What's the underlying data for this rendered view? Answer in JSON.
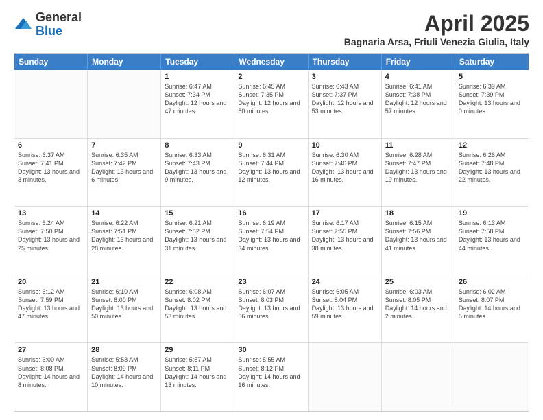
{
  "header": {
    "logo_general": "General",
    "logo_blue": "Blue",
    "month_title": "April 2025",
    "location": "Bagnaria Arsa, Friuli Venezia Giulia, Italy"
  },
  "day_names": [
    "Sunday",
    "Monday",
    "Tuesday",
    "Wednesday",
    "Thursday",
    "Friday",
    "Saturday"
  ],
  "weeks": [
    [
      {
        "day": "",
        "empty": true
      },
      {
        "day": "",
        "empty": true
      },
      {
        "day": "1",
        "sunrise": "6:47 AM",
        "sunset": "7:34 PM",
        "daylight": "12 hours and 47 minutes."
      },
      {
        "day": "2",
        "sunrise": "6:45 AM",
        "sunset": "7:35 PM",
        "daylight": "12 hours and 50 minutes."
      },
      {
        "day": "3",
        "sunrise": "6:43 AM",
        "sunset": "7:37 PM",
        "daylight": "12 hours and 53 minutes."
      },
      {
        "day": "4",
        "sunrise": "6:41 AM",
        "sunset": "7:38 PM",
        "daylight": "12 hours and 57 minutes."
      },
      {
        "day": "5",
        "sunrise": "6:39 AM",
        "sunset": "7:39 PM",
        "daylight": "13 hours and 0 minutes."
      }
    ],
    [
      {
        "day": "6",
        "sunrise": "6:37 AM",
        "sunset": "7:41 PM",
        "daylight": "13 hours and 3 minutes."
      },
      {
        "day": "7",
        "sunrise": "6:35 AM",
        "sunset": "7:42 PM",
        "daylight": "13 hours and 6 minutes."
      },
      {
        "day": "8",
        "sunrise": "6:33 AM",
        "sunset": "7:43 PM",
        "daylight": "13 hours and 9 minutes."
      },
      {
        "day": "9",
        "sunrise": "6:31 AM",
        "sunset": "7:44 PM",
        "daylight": "13 hours and 12 minutes."
      },
      {
        "day": "10",
        "sunrise": "6:30 AM",
        "sunset": "7:46 PM",
        "daylight": "13 hours and 16 minutes."
      },
      {
        "day": "11",
        "sunrise": "6:28 AM",
        "sunset": "7:47 PM",
        "daylight": "13 hours and 19 minutes."
      },
      {
        "day": "12",
        "sunrise": "6:26 AM",
        "sunset": "7:48 PM",
        "daylight": "13 hours and 22 minutes."
      }
    ],
    [
      {
        "day": "13",
        "sunrise": "6:24 AM",
        "sunset": "7:50 PM",
        "daylight": "13 hours and 25 minutes."
      },
      {
        "day": "14",
        "sunrise": "6:22 AM",
        "sunset": "7:51 PM",
        "daylight": "13 hours and 28 minutes."
      },
      {
        "day": "15",
        "sunrise": "6:21 AM",
        "sunset": "7:52 PM",
        "daylight": "13 hours and 31 minutes."
      },
      {
        "day": "16",
        "sunrise": "6:19 AM",
        "sunset": "7:54 PM",
        "daylight": "13 hours and 34 minutes."
      },
      {
        "day": "17",
        "sunrise": "6:17 AM",
        "sunset": "7:55 PM",
        "daylight": "13 hours and 38 minutes."
      },
      {
        "day": "18",
        "sunrise": "6:15 AM",
        "sunset": "7:56 PM",
        "daylight": "13 hours and 41 minutes."
      },
      {
        "day": "19",
        "sunrise": "6:13 AM",
        "sunset": "7:58 PM",
        "daylight": "13 hours and 44 minutes."
      }
    ],
    [
      {
        "day": "20",
        "sunrise": "6:12 AM",
        "sunset": "7:59 PM",
        "daylight": "13 hours and 47 minutes."
      },
      {
        "day": "21",
        "sunrise": "6:10 AM",
        "sunset": "8:00 PM",
        "daylight": "13 hours and 50 minutes."
      },
      {
        "day": "22",
        "sunrise": "6:08 AM",
        "sunset": "8:02 PM",
        "daylight": "13 hours and 53 minutes."
      },
      {
        "day": "23",
        "sunrise": "6:07 AM",
        "sunset": "8:03 PM",
        "daylight": "13 hours and 56 minutes."
      },
      {
        "day": "24",
        "sunrise": "6:05 AM",
        "sunset": "8:04 PM",
        "daylight": "13 hours and 59 minutes."
      },
      {
        "day": "25",
        "sunrise": "6:03 AM",
        "sunset": "8:05 PM",
        "daylight": "14 hours and 2 minutes."
      },
      {
        "day": "26",
        "sunrise": "6:02 AM",
        "sunset": "8:07 PM",
        "daylight": "14 hours and 5 minutes."
      }
    ],
    [
      {
        "day": "27",
        "sunrise": "6:00 AM",
        "sunset": "8:08 PM",
        "daylight": "14 hours and 8 minutes."
      },
      {
        "day": "28",
        "sunrise": "5:58 AM",
        "sunset": "8:09 PM",
        "daylight": "14 hours and 10 minutes."
      },
      {
        "day": "29",
        "sunrise": "5:57 AM",
        "sunset": "8:11 PM",
        "daylight": "14 hours and 13 minutes."
      },
      {
        "day": "30",
        "sunrise": "5:55 AM",
        "sunset": "8:12 PM",
        "daylight": "14 hours and 16 minutes."
      },
      {
        "day": "",
        "empty": true
      },
      {
        "day": "",
        "empty": true
      },
      {
        "day": "",
        "empty": true
      }
    ]
  ],
  "labels": {
    "sunrise": "Sunrise:",
    "sunset": "Sunset:",
    "daylight": "Daylight:"
  }
}
